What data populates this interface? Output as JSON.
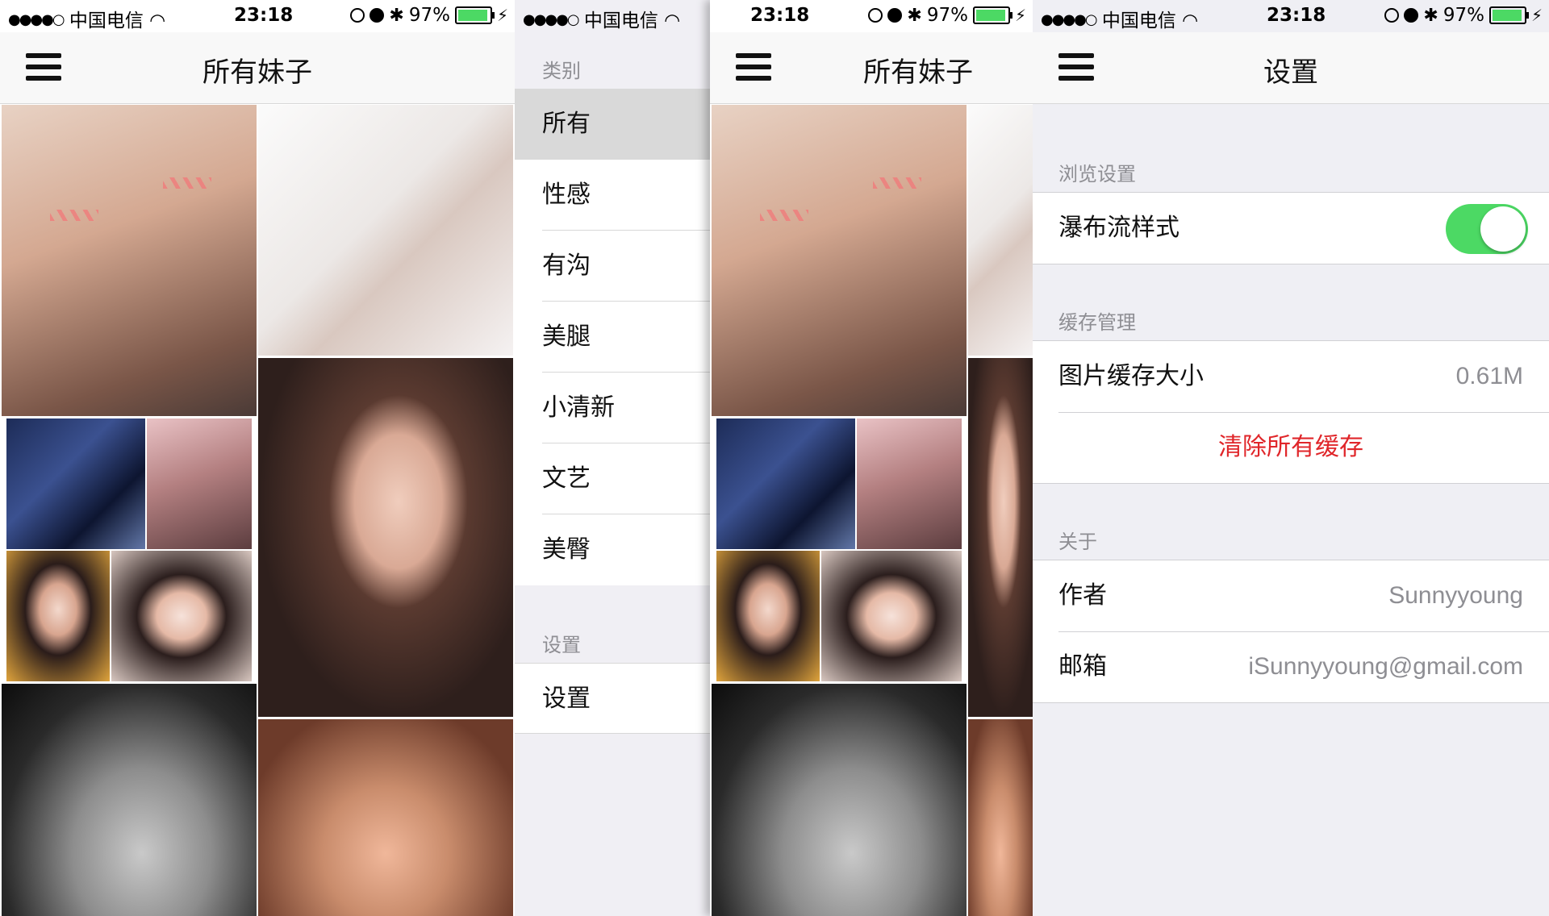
{
  "status": {
    "signal_dots": "●●●●○",
    "carrier": "中国电信",
    "time": "23:18",
    "battery": "97%",
    "battery_level": 0.97
  },
  "home": {
    "title": "所有妹子"
  },
  "menu": {
    "section_category": "类别",
    "items": [
      {
        "label": "所有"
      },
      {
        "label": "性感"
      },
      {
        "label": "有沟"
      },
      {
        "label": "美腿"
      },
      {
        "label": "小清新"
      },
      {
        "label": "文艺"
      },
      {
        "label": "美臀"
      }
    ],
    "selected_index": 0,
    "section_settings": "设置",
    "settings_item": "设置"
  },
  "settings": {
    "title": "设置",
    "browse_header": "浏览设置",
    "waterfall_label": "瀑布流样式",
    "waterfall_on": true,
    "cache_header": "缓存管理",
    "cache_size_label": "图片缓存大小",
    "cache_size_value": "0.61M",
    "clear_cache": "清除所有缓存",
    "about_header": "关于",
    "author_label": "作者",
    "author_value": "Sunnyyoung",
    "email_label": "邮箱",
    "email_value": "iSunnyyoung@gmail.com"
  },
  "colors": {
    "toggle_on": "#4cd964",
    "destructive": "#e0262a",
    "menu_selected": "#d9d9d9"
  }
}
